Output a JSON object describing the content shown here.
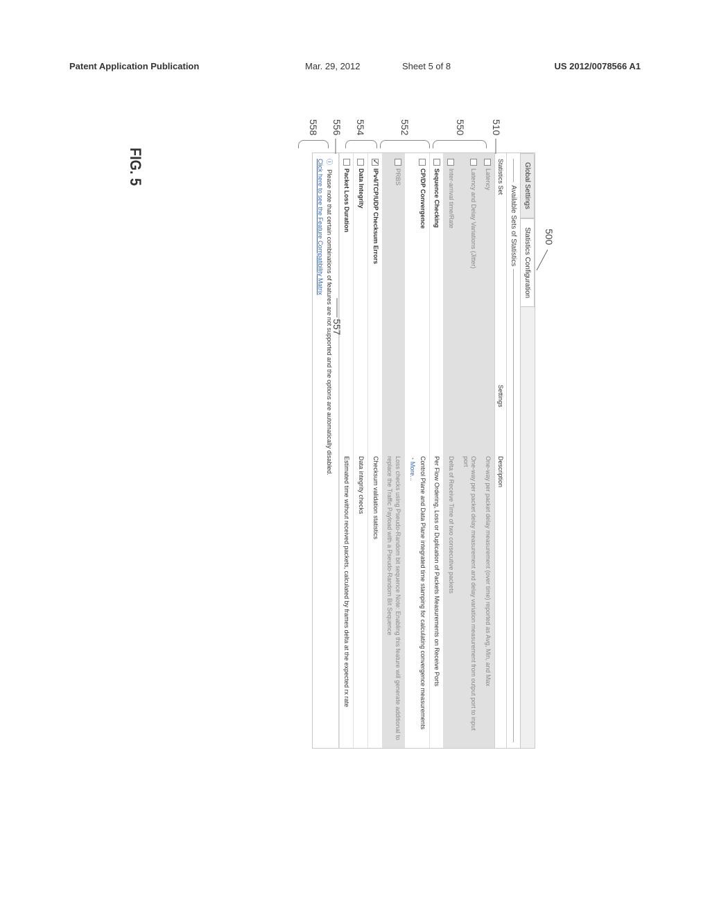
{
  "header": {
    "publication": "Patent Application Publication",
    "date": "Mar. 29, 2012",
    "sheet": "Sheet 5 of 8",
    "patent_no": "US 2012/0078566 A1"
  },
  "figure_label": "FIG. 5",
  "callouts": {
    "c500": "500",
    "c510": "510",
    "c550": "550",
    "c552": "552",
    "c554": "554",
    "c556": "556",
    "c557": "557",
    "c558": "558"
  },
  "window": {
    "tabs": [
      "Global Settings",
      "Statistics Configuration"
    ],
    "fieldset": "Available Sets of Statistics",
    "columns": {
      "name": "Statistics Set",
      "settings": "Settings",
      "desc": "Description"
    },
    "rows": [
      {
        "id": "latency",
        "disabled": true,
        "checked": false,
        "name": "Latency",
        "desc": "One-way per packet delay measurement (over time) reported as Avg, Min, and Max"
      },
      {
        "id": "jitter",
        "disabled": true,
        "checked": false,
        "name": "Latency and Delay Variations (Jitter)",
        "desc": "One-way per packet delay measurement and delay variation measurement from output port to input port"
      },
      {
        "id": "interarrival",
        "disabled": true,
        "checked": false,
        "name": "Inter-arrival time/Rate",
        "desc": "Delta of Receive Time of two consecutive packets"
      },
      {
        "id": "sequence",
        "disabled": false,
        "checked": false,
        "name": "Sequence Checking",
        "desc": "Per Flow Ordering, Loss or Duplication of Packets Measurements on Receive Ports"
      },
      {
        "id": "convergence",
        "disabled": false,
        "checked": false,
        "name": "CP/DP Convergence",
        "desc": "Control Plane and Data Plane integrated time stamping for calculating convergence measurements",
        "more": "More..."
      },
      {
        "id": "prbs",
        "disabled": true,
        "checked": false,
        "name": "PRBS",
        "desc": "Loss checks using Pseudo-Random bit sequence\nNote: Enabling this feature will generate additional to replace the Traffic Payload with a Pseudo-Random Bit Sequence"
      },
      {
        "id": "checksum",
        "disabled": false,
        "checked": true,
        "name": "IPv4/TCP/UDP Checksum Errors",
        "desc": "Checksum validation statistics"
      },
      {
        "id": "integrity",
        "disabled": false,
        "checked": false,
        "name": "Data Integrity",
        "desc": "Data integrity checks"
      },
      {
        "id": "packetloss",
        "disabled": false,
        "checked": false,
        "name": "Packet Loss Duration",
        "desc": "Estimated time without received packets, calculated by frames delta at the expected rx rate"
      }
    ],
    "footer": {
      "note": "Please note that certain combinations of features are not supported and the options are automatically disabled.",
      "link": "Click here to see the Feature Compatibility Matrix"
    }
  }
}
